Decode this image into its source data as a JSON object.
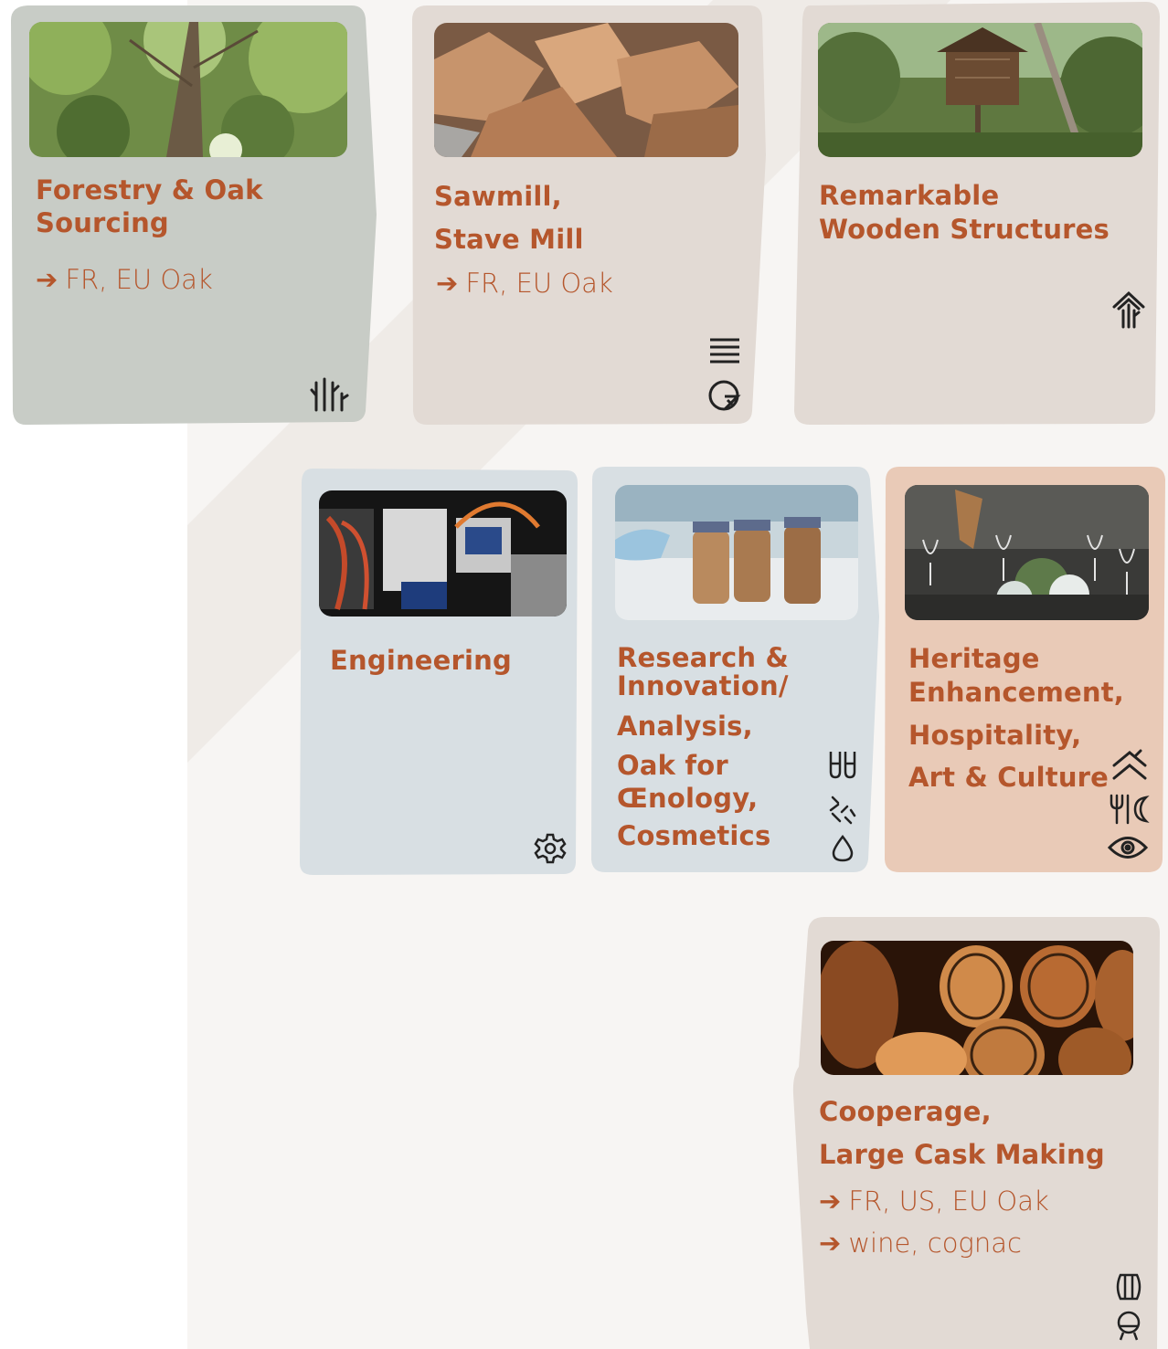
{
  "colors": {
    "accent_text": "#b5562c",
    "card_forestry": "#c8ccc6",
    "card_sawmill": "#e2dad4",
    "card_structures": "#e2dad4",
    "card_engineering": "#d8dfe3",
    "card_research": "#d8dfe3",
    "card_heritage": "#e9cab7",
    "card_cooperage": "#e2dad4",
    "icon_stroke": "#222222"
  },
  "cards": {
    "forestry": {
      "title": [
        "Forestry & Oak",
        "Sourcing"
      ],
      "notes": [
        "FR, EU Oak"
      ],
      "photo": "tree-canopy-photo",
      "icons": [
        "forest-icon"
      ]
    },
    "sawmill": {
      "title": [
        "Sawmill,",
        "Stave Mill"
      ],
      "notes": [
        "FR, EU Oak"
      ],
      "photo": "split-wood-photo",
      "icons": [
        "planks-icon",
        "log-cross-section-icon"
      ]
    },
    "structures": {
      "title": [
        "Remarkable",
        "Wooden Structures"
      ],
      "notes": [],
      "photo": "treehouse-photo",
      "icons": [
        "wooden-house-icon"
      ]
    },
    "engineering": {
      "title": [
        "Engineering"
      ],
      "notes": [],
      "photo": "machinery-photo",
      "icons": [
        "gear-icon"
      ]
    },
    "research": {
      "title": [
        "Research &",
        "Innovation/",
        "Analysis,",
        "Oak for",
        "Œnology,",
        "Cosmetics"
      ],
      "notes": [],
      "photo": "jars-of-oak-chips-photo",
      "icons": [
        "test-tubes-icon",
        "oak-chips-icon",
        "drop-icon"
      ]
    },
    "heritage": {
      "title": [
        "Heritage",
        "Enhancement,",
        "Hospitality,",
        "Art & Culture"
      ],
      "notes": [],
      "photo": "table-setting-photo",
      "icons": [
        "roof-icon",
        "fork-moon-icon",
        "eye-icon"
      ]
    },
    "cooperage": {
      "title": [
        "Cooperage,",
        "Large Cask Making"
      ],
      "notes": [
        "FR, US, EU Oak",
        "wine, cognac"
      ],
      "photo": "barrels-photo",
      "icons": [
        "barrel-icon",
        "cask-icon"
      ]
    }
  },
  "arrow_glyph": "➔"
}
